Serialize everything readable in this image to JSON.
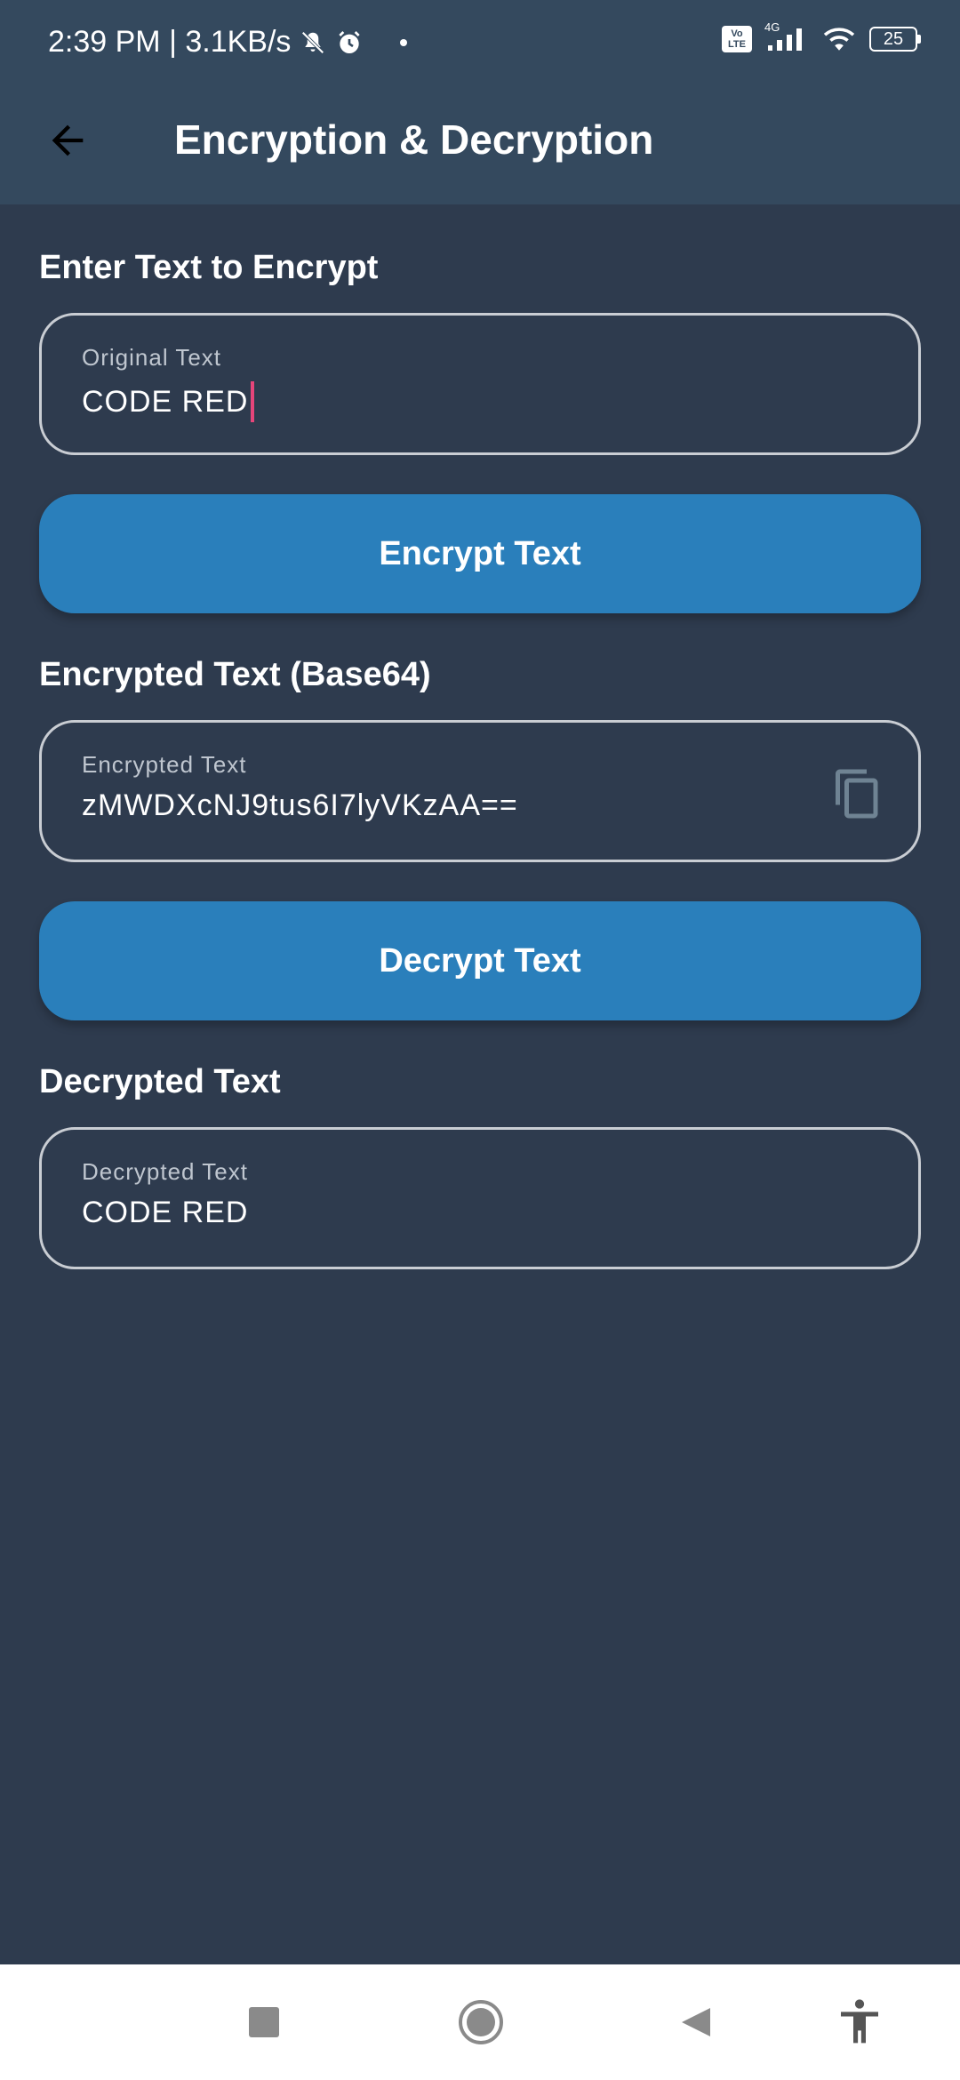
{
  "status_bar": {
    "time_speed": "2:39 PM | 3.1KB/s",
    "volte": "Vo LTE",
    "network": "4G",
    "battery": "25"
  },
  "app_bar": {
    "title": "Encryption & Decryption"
  },
  "encrypt_section": {
    "heading": "Enter Text to Encrypt",
    "field_label": "Original Text",
    "field_value": "CODE RED",
    "button_label": "Encrypt Text"
  },
  "encrypted_section": {
    "heading": "Encrypted Text (Base64)",
    "field_label": "Encrypted Text",
    "field_value": "zMWDXcNJ9tus6I7lyVKzAA==",
    "button_label": "Decrypt Text"
  },
  "decrypted_section": {
    "heading": "Decrypted Text",
    "field_label": "Decrypted Text",
    "field_value": "CODE RED"
  },
  "colors": {
    "background": "#2E3B4E",
    "app_bar": "#34495E",
    "button": "#2A7FBB",
    "cursor": "#E6457A",
    "field_border": "#C9CDD3"
  },
  "icons": {
    "back": "arrow-left-icon",
    "copy": "copy-icon",
    "mute": "bell-off-icon",
    "alarm": "alarm-clock-icon",
    "signal": "signal-icon",
    "wifi": "wifi-icon",
    "nav_recent": "square-icon",
    "nav_home": "circle-icon",
    "nav_back": "triangle-back-icon",
    "accessibility": "accessibility-icon"
  }
}
